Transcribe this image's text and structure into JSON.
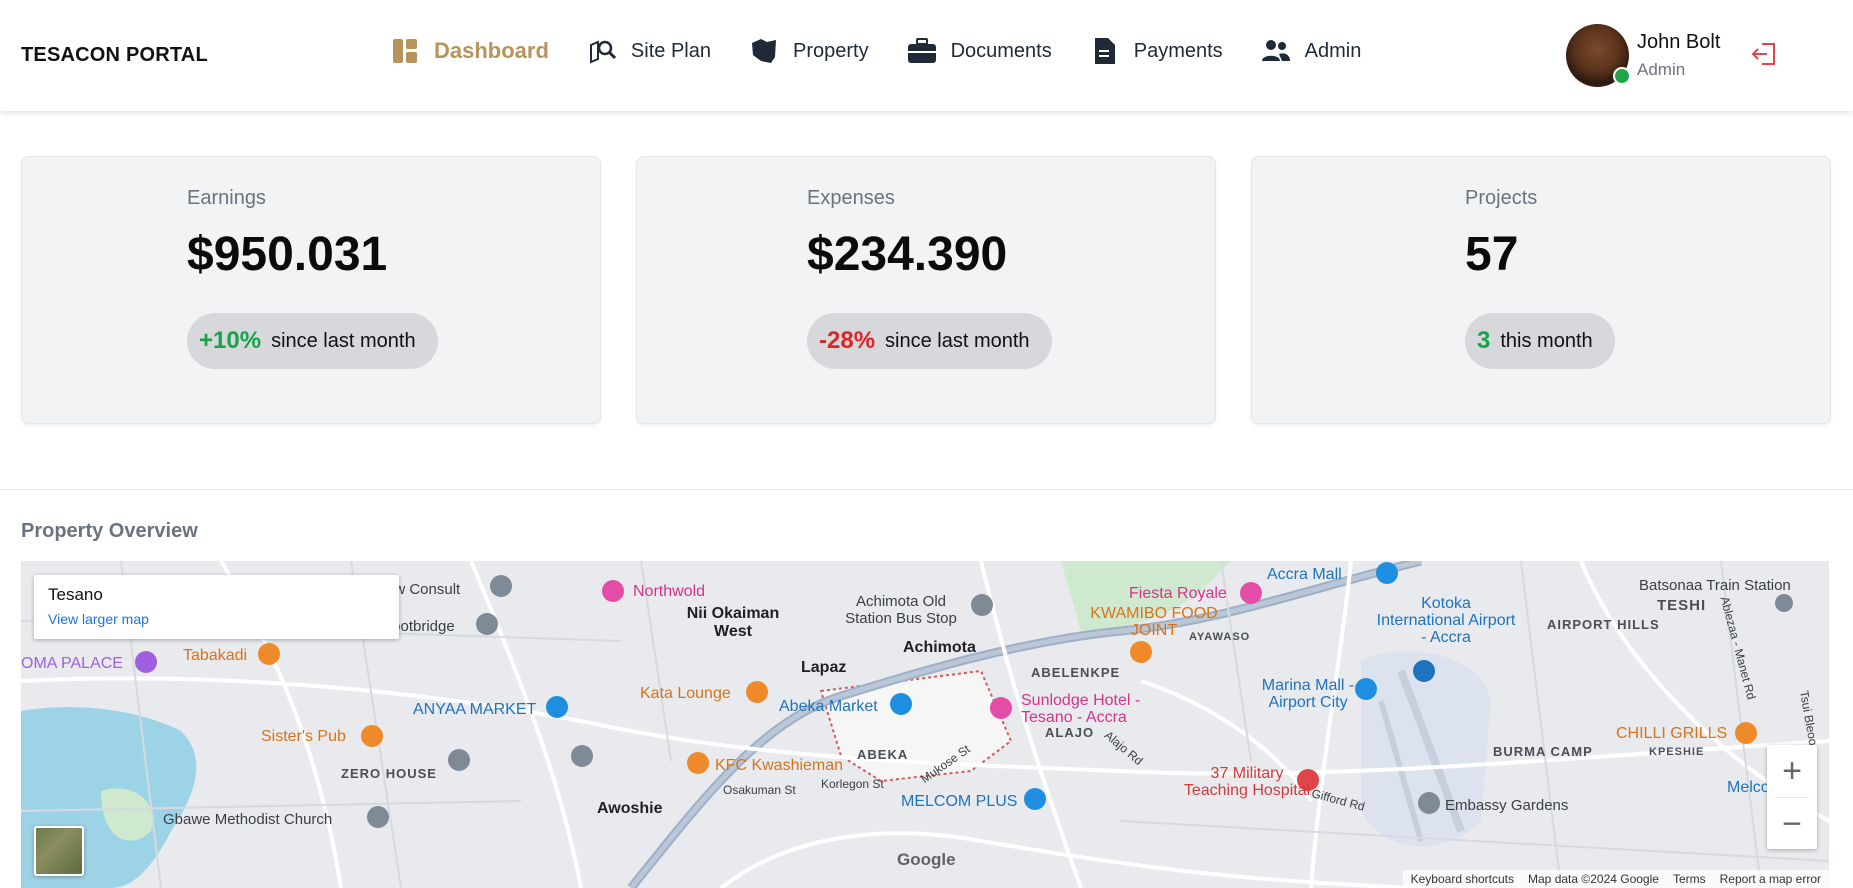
{
  "brand": "TESACON PORTAL",
  "nav": [
    {
      "label": "Dashboard",
      "icon": "dashboard-icon",
      "active": true
    },
    {
      "label": "Site Plan",
      "icon": "map-search-icon"
    },
    {
      "label": "Property",
      "icon": "map-region-icon"
    },
    {
      "label": "Documents",
      "icon": "briefcase-icon"
    },
    {
      "label": "Payments",
      "icon": "document-icon"
    },
    {
      "label": "Admin",
      "icon": "users-icon"
    }
  ],
  "user": {
    "name": "John Bolt",
    "role": "Admin"
  },
  "cards": [
    {
      "label": "Earnings",
      "value": "$950.031",
      "delta": "+10%",
      "note": "since last month"
    },
    {
      "label": "Expenses",
      "value": "$234.390",
      "delta": "-28%",
      "note": "since last month"
    },
    {
      "label": "Projects",
      "value": "57",
      "delta": "3",
      "note": "this month"
    }
  ],
  "overview": {
    "title": "Property Overview",
    "map": {
      "place": "Tesano",
      "larger_map_link": "View larger map",
      "labels": [
        "Northwold",
        "Achimota Old Station Bus Stop",
        "Accra Mall",
        "Batsonaa Train Station",
        "Nii Okaiman West",
        "Fiesta Royale",
        "Kotoka International Airport - Accra",
        "TESHI",
        "KWAMIBO FOOD JOINT",
        "AIRPORT HILLS",
        "Achimota",
        "AYAWASO",
        "Tabakadi",
        "OMA PALACE",
        "Lapaz",
        "ABELENKPE",
        "Kata Lounge",
        "Sunlodge Hotel - Tesano - Accra",
        "Marina Mall - Airport City",
        "ANYAA MARKET",
        "Abeka Market",
        "ALAJO",
        "Sister's Pub",
        "CHILLI GRILLS",
        "BURMA CAMP",
        "KPESHIE",
        "ZERO HOUSE",
        "KFC Kwashieman",
        "ABEKA",
        "37 Military Teaching Hospital",
        "Awoshie",
        "MELCOM PLUS",
        "Embassy Gardens",
        "Gbawe Methodist Church",
        "aw Consult",
        "NIC Footbridge",
        "Osakuman St",
        "Korlegon St",
        "Mukose St",
        "Alajo Rd",
        "Gifford Rd",
        "Ablezaa - Manet Rd",
        "Tsui Bleoo",
        "Melco"
      ],
      "attribution": [
        "Keyboard shortcuts",
        "Map data ©2024 Google",
        "Terms",
        "Report a map error"
      ],
      "logo": "Google"
    }
  },
  "colors": {
    "accent": "#b8945c",
    "positive": "#16a34a",
    "negative": "#dc2626"
  }
}
